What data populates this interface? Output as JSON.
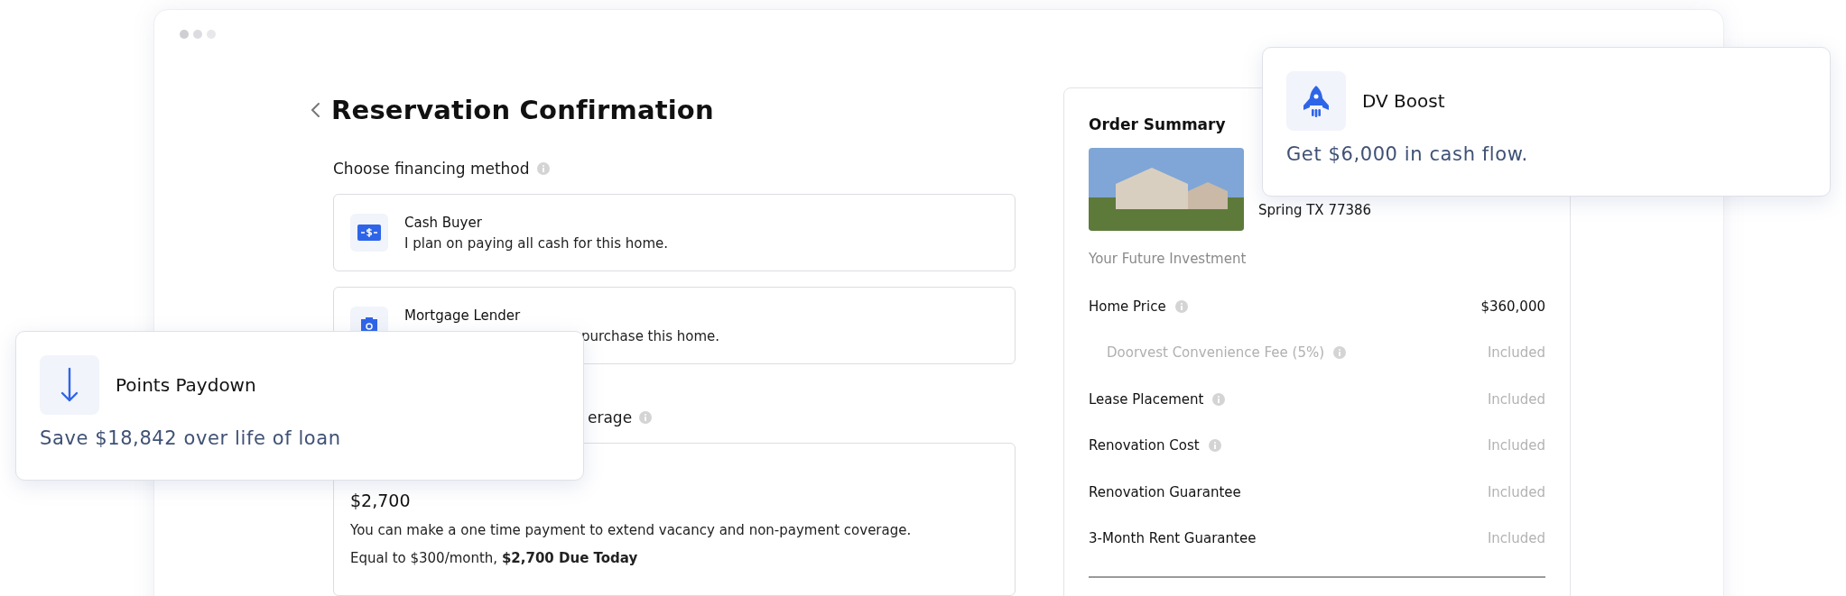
{
  "page": {
    "title": "Reservation Confirmation"
  },
  "financing": {
    "heading": "Choose financing method",
    "options": [
      {
        "kind": "cash",
        "title": "Cash Buyer",
        "description": "I plan on paying all cash for this home.",
        "covered": false
      },
      {
        "kind": "mortgage",
        "title": "Mortgage Lender",
        "description": "purchase this home.",
        "covered": true
      }
    ]
  },
  "coverage": {
    "heading": "erage",
    "amount": "$2,700",
    "description": "You can make a one time payment to extend vacancy and non-payment coverage.",
    "note": "Equal to $300/month, **$2,700 Due Today**"
  },
  "order_summary": {
    "title": "Order Summary",
    "address": "Spring TX 77386",
    "section": "Your Future Investment",
    "rows": [
      {
        "label": "Home Price",
        "value": "$360,000",
        "info": true,
        "sub": false,
        "value_strong": true
      },
      {
        "label": "Doorvest Convenience Fee (5%)",
        "value": "Included",
        "info": true,
        "sub": true,
        "value_strong": false
      },
      {
        "label": "Lease Placement",
        "value": "Included",
        "info": true,
        "sub": false,
        "value_strong": false
      },
      {
        "label": "Renovation Cost",
        "value": "Included",
        "info": true,
        "sub": false,
        "value_strong": false
      },
      {
        "label": "Renovation Guarantee",
        "value": "Included",
        "info": false,
        "sub": false,
        "value_strong": false
      },
      {
        "label": "3-Month Rent Guarantee",
        "value": "Included",
        "info": false,
        "sub": false,
        "value_strong": false
      }
    ]
  },
  "popups": [
    {
      "kind": "arrow",
      "title": "Points Paydown",
      "text": "Save $18,842 over life of loan"
    },
    {
      "kind": "rocket",
      "title": "DV Boost",
      "text": "Get $6,000 in cash flow."
    }
  ]
}
